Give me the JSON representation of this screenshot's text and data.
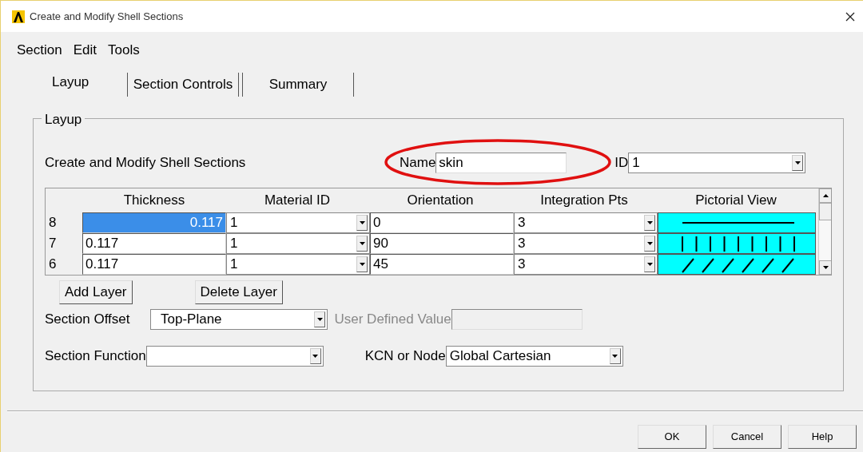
{
  "window": {
    "title": "Create and Modify Shell Sections"
  },
  "menu": [
    "Section",
    "Edit",
    "Tools"
  ],
  "tabs": [
    {
      "label": "Layup",
      "selected": true
    },
    {
      "label": "Section Controls",
      "selected": false
    },
    {
      "label": "Summary",
      "selected": false
    }
  ],
  "group": {
    "title": "Layup",
    "heading": "Create and Modify Shell Sections",
    "name_label": "Name",
    "name_value": "skin",
    "id_label": "ID",
    "id_value": "1"
  },
  "annotation": {
    "kind": "ellipse",
    "color": "#e01010"
  },
  "table": {
    "columns": [
      "Thickness",
      "Material ID",
      "Orientation",
      "Integration Pts",
      "Pictorial View"
    ],
    "rows": [
      {
        "layer": "8",
        "thickness": "0.117",
        "selected": true,
        "material": "1",
        "orientation": "0",
        "integration": "3",
        "kind": "horizontal"
      },
      {
        "layer": "7",
        "thickness": "0.117",
        "selected": false,
        "material": "1",
        "orientation": "90",
        "integration": "3",
        "kind": "vertical"
      },
      {
        "layer": "6",
        "thickness": "0.117",
        "selected": false,
        "material": "1",
        "orientation": "45",
        "integration": "3",
        "kind": "diagonal"
      }
    ]
  },
  "layer_buttons": [
    "Add Layer",
    "Delete Layer"
  ],
  "section_offset": {
    "label": "Section Offset",
    "value": "Top-Plane"
  },
  "user_defined": {
    "label": "User Defined Value",
    "disabled": true
  },
  "section_function": {
    "label": "Section Function"
  },
  "kcn": {
    "label": "KCN or Node",
    "value": "Global Cartesian"
  },
  "buttons": [
    "OK",
    "Cancel",
    "Help"
  ]
}
